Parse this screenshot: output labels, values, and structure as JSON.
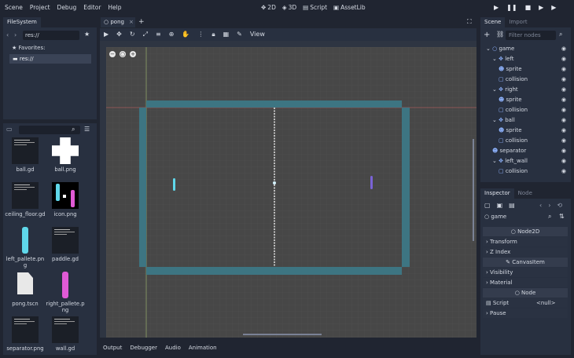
{
  "menubar": {
    "items": [
      "Scene",
      "Project",
      "Debug",
      "Editor",
      "Help"
    ]
  },
  "modes": {
    "m2d": "2D",
    "m3d": "3D",
    "script": "Script",
    "assetlib": "AssetLib"
  },
  "filesystem": {
    "tab": "FileSystem",
    "path": "res://",
    "favorites": "Favorites:",
    "res": "res://",
    "files": [
      {
        "name": "ball.gd",
        "kind": "script"
      },
      {
        "name": "ball.png",
        "kind": "ball"
      },
      {
        "name": "ceiling_floor.gd",
        "kind": "script"
      },
      {
        "name": "icon.png",
        "kind": "icon"
      },
      {
        "name": "left_pallete.pn\ng",
        "kind": "paddle-cyan"
      },
      {
        "name": "paddle.gd",
        "kind": "script"
      },
      {
        "name": "pong.tscn",
        "kind": "scene"
      },
      {
        "name": "right_pallete.p\nng",
        "kind": "paddle-pink"
      },
      {
        "name": "separator.png",
        "kind": "script"
      },
      {
        "name": "wall.gd",
        "kind": "script"
      }
    ]
  },
  "editor": {
    "scene_tab": "pong",
    "view_label": "View",
    "bottom_tabs": [
      "Output",
      "Debugger",
      "Audio",
      "Animation"
    ]
  },
  "scene": {
    "tab_scene": "Scene",
    "tab_import": "Import",
    "filter_placeholder": "Filter nodes",
    "nodes": [
      "game",
      "left",
      "sprite",
      "collision",
      "right",
      "sprite",
      "collision",
      "ball",
      "sprite",
      "collision",
      "separator",
      "left_wall",
      "collision"
    ]
  },
  "inspector": {
    "tab_inspector": "Inspector",
    "tab_node": "Node",
    "object": "game",
    "sections": {
      "node2d": "Node2D",
      "transform": "Transform",
      "zindex": "Z Index",
      "canvasitem": "CanvasItem",
      "visibility": "Visibility",
      "material": "Material",
      "node": "Node",
      "script": "Script",
      "script_value": "<null>",
      "pause": "Pause"
    }
  },
  "colors": {
    "accent": "#7ab2ff",
    "wall": "#3d7582",
    "paddle_left": "#5fd7ea",
    "paddle_right": "#7a63d6"
  }
}
